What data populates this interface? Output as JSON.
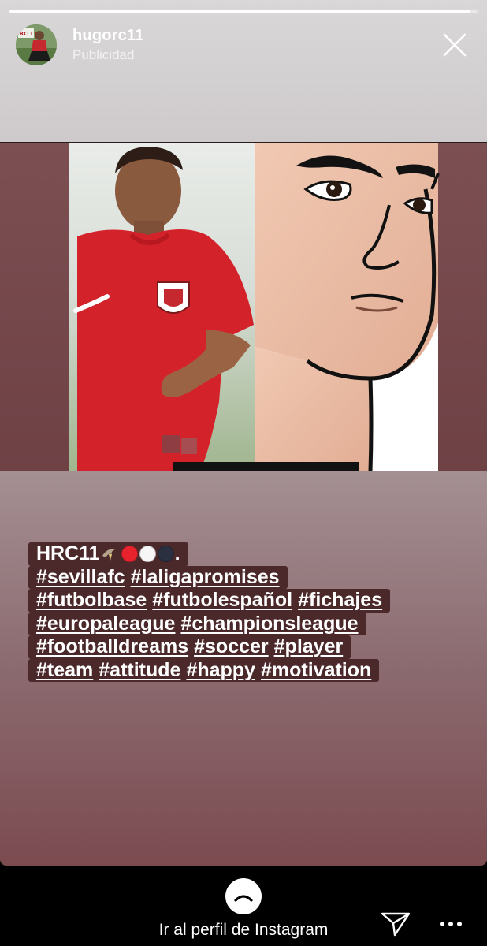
{
  "progress": {
    "fraction": 0.985
  },
  "header": {
    "username": "hugorc11",
    "subtitle": "Publicidad",
    "avatar_text": "HRC 11"
  },
  "caption": {
    "line1_text": "HRC11",
    "line1_emojis": [
      "bird-emoji",
      "red-circle-emoji",
      "white-circle-emoji",
      "black-circle-emoji"
    ],
    "line1_suffix": ".",
    "hashtag_rows": [
      [
        "#sevillafc",
        "#laligapromises"
      ],
      [
        "#futbolbase",
        "#futbolespañol",
        "#fichajes"
      ],
      [
        "#europaleague",
        "#championsleague"
      ],
      [
        "#footballdreams",
        "#soccer",
        "#player"
      ],
      [
        "#team",
        "#attitude",
        "#happy",
        "#motivation"
      ]
    ]
  },
  "footer": {
    "cta_label": "Ir al perfil de Instagram"
  },
  "colors": {
    "caption_bg": "#4b292b",
    "story_bottom": "#7b4b50",
    "jersey_red": "#d3222a"
  },
  "icons": {
    "close": "close-icon",
    "up": "chevron-up-icon",
    "send": "paper-plane-icon",
    "more": "more-dots-icon"
  }
}
